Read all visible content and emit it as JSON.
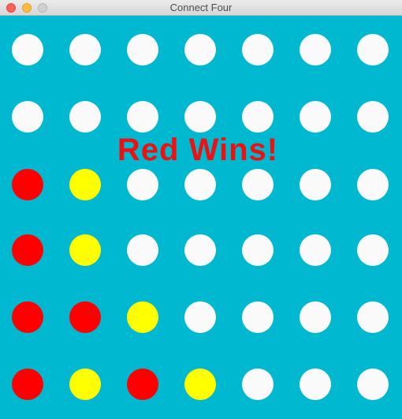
{
  "window": {
    "title": "Connect Four"
  },
  "colors": {
    "board": "#00b8d0",
    "empty": "#fafafa",
    "red": "#ff0000",
    "yellow": "#ffff00",
    "message": "#ee1111"
  },
  "game": {
    "status_message": "Red Wins!",
    "columns": 7,
    "rows": 6,
    "board": [
      [
        "empty",
        "empty",
        "empty",
        "empty",
        "empty",
        "empty",
        "empty"
      ],
      [
        "empty",
        "empty",
        "empty",
        "empty",
        "empty",
        "empty",
        "empty"
      ],
      [
        "red",
        "yellow",
        "empty",
        "empty",
        "empty",
        "empty",
        "empty"
      ],
      [
        "red",
        "yellow",
        "empty",
        "empty",
        "empty",
        "empty",
        "empty"
      ],
      [
        "red",
        "red",
        "yellow",
        "empty",
        "empty",
        "empty",
        "empty"
      ],
      [
        "red",
        "yellow",
        "red",
        "yellow",
        "empty",
        "empty",
        "empty"
      ]
    ]
  }
}
